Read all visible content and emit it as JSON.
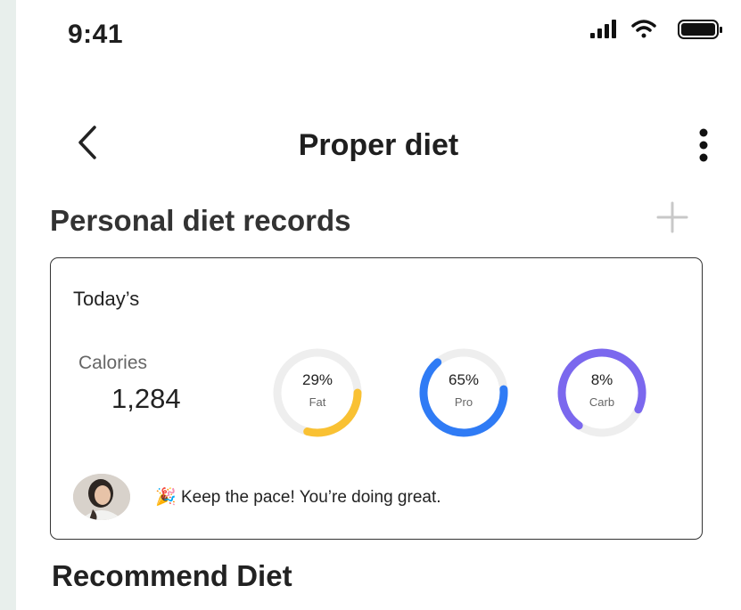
{
  "status_bar": {
    "time": "9:41"
  },
  "header": {
    "title": "Proper diet"
  },
  "personal_records": {
    "title": "Personal diet records",
    "card": {
      "heading": "Today’s",
      "calories_label": "Calories",
      "calories_value": "1,284",
      "macros": [
        {
          "percent": "29%",
          "label": "Fat",
          "fraction": 0.29,
          "color": "#f9c133"
        },
        {
          "percent": "65%",
          "label": "Pro",
          "fraction": 0.65,
          "color": "#2f7bf5"
        },
        {
          "percent": "8%",
          "label": "Carb",
          "fraction": 0.72,
          "color": "#7b68ee"
        }
      ],
      "message_emoji": "🎉",
      "message": "Keep the pace! You’re doing great."
    }
  },
  "recommend": {
    "title": "Recommend Diet"
  },
  "icons": {
    "back": "chevron-left-icon",
    "more": "more-vertical-icon",
    "add": "plus-icon",
    "signal": "signal-icon",
    "wifi": "wifi-icon",
    "battery": "battery-icon"
  },
  "colors": {
    "track": "#eeeeee",
    "card_border": "#333333"
  }
}
